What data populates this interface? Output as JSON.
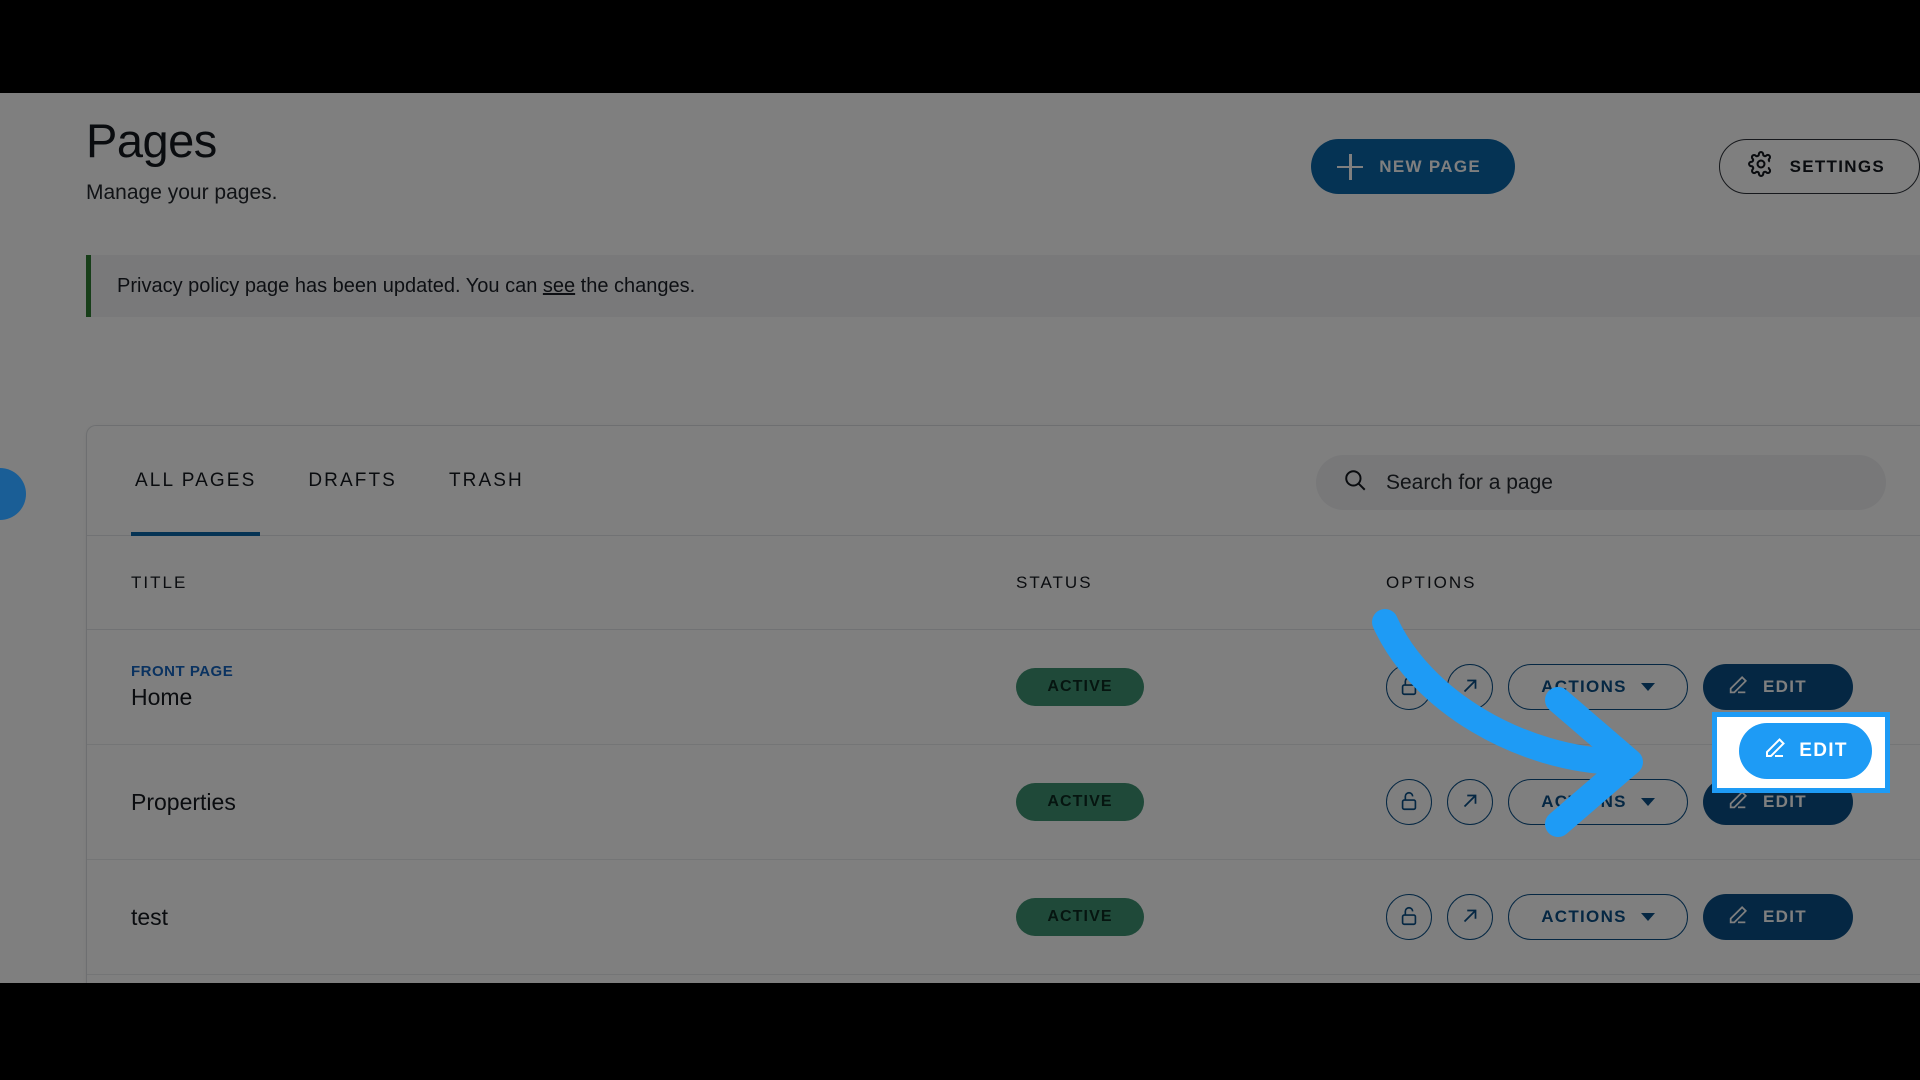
{
  "header": {
    "title": "Pages",
    "subtitle": "Manage your pages.",
    "new_page_label": "NEW PAGE",
    "settings_label": "SETTINGS"
  },
  "banner": {
    "text_before": "Privacy policy page has been updated. You can ",
    "link_label": "see",
    "text_after": " the changes.",
    "accent_color": "#2e7d32"
  },
  "tabs": [
    {
      "label": "ALL PAGES",
      "active": true
    },
    {
      "label": "DRAFTS",
      "active": false
    },
    {
      "label": "TRASH",
      "active": false
    }
  ],
  "search": {
    "placeholder": "Search for a page",
    "value": ""
  },
  "table": {
    "columns": [
      "TITLE",
      "STATUS",
      "OPTIONS"
    ],
    "rows": [
      {
        "tag": "FRONT PAGE",
        "title": "Home",
        "status": "ACTIVE",
        "actions_label": "ACTIONS",
        "edit_label": "EDIT",
        "highlighted": true
      },
      {
        "tag": "",
        "title": "Properties",
        "status": "ACTIVE",
        "actions_label": "ACTIONS",
        "edit_label": "EDIT",
        "highlighted": false
      },
      {
        "tag": "",
        "title": "test",
        "status": "ACTIVE",
        "actions_label": "ACTIONS",
        "edit_label": "EDIT",
        "highlighted": false
      }
    ]
  },
  "annotation": {
    "highlighted_edit_label": "EDIT",
    "arrow_color": "#1e9bf5",
    "highlight_color": "#1e9bf5"
  },
  "colors": {
    "primary_blue": "#0a66a8",
    "link_blue": "#1565c0",
    "badge_green": "#3f9373",
    "annotation_blue": "#1e9bf5"
  }
}
